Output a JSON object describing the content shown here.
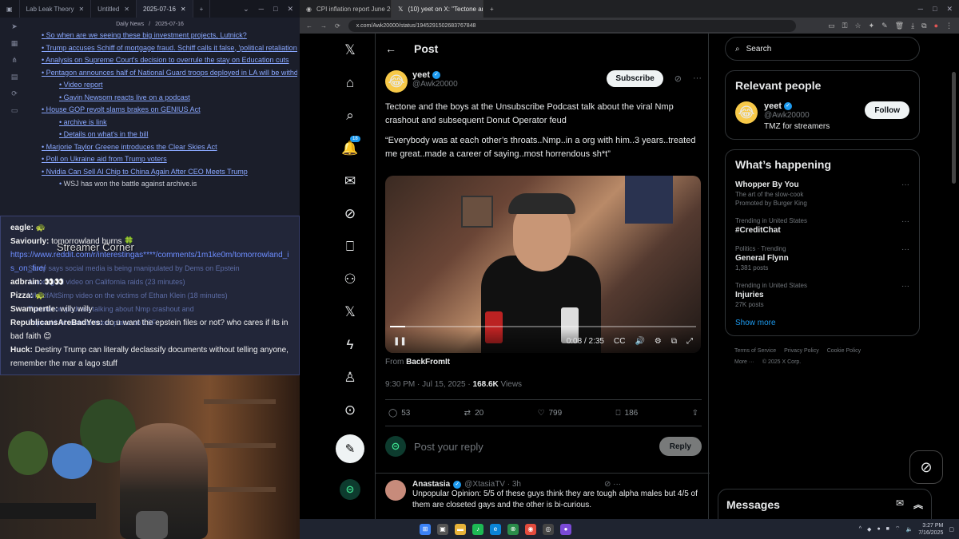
{
  "notes": {
    "tabs": [
      "Lab Leak Theory",
      "Untitled",
      "2025-07-16"
    ],
    "bar_left": "Daily News",
    "bar_right": "2025-07-16",
    "items": [
      {
        "text": "So when are we seeing these big investment projects, Lutnick?",
        "level": 1
      },
      {
        "text": "Trump accuses Schiff of mortgage fraud. Schiff calls it false, 'political retaliation' - Los Angeles Times",
        "level": 1
      },
      {
        "text": "Analysis on Supreme Court's decision to overrule the stay on Education cuts",
        "level": 1
      },
      {
        "text": "Pentagon announces half of National Guard troops deployed in LA will be withdrawn",
        "level": 1
      },
      {
        "text": "Video report",
        "level": 2
      },
      {
        "text": "Gavin Newsom reacts live on a podcast",
        "level": 2
      },
      {
        "text": "House GOP revolt slams brakes on GENIUS Act",
        "level": 1
      },
      {
        "text": "archive is link",
        "level": 2
      },
      {
        "text": "Details on what's in the bill",
        "level": 2
      },
      {
        "text": "Marjorie Taylor Greene introduces the Clear Skies Act",
        "level": 1
      },
      {
        "text": "Poll on Ukraine aid from Trump voters",
        "level": 1
      },
      {
        "text": "Nvidia Can Sell AI Chip to China Again After CEO Meets Trump",
        "level": 1
      },
      {
        "text": "WSJ has won the battle against archive.is",
        "level": 3
      }
    ]
  },
  "chat": {
    "title": "Streamer Corner",
    "ghost_lines": [
      "Study says social media is being manipulated by Dems on Epstein",
      "Asmongold video on California raids (23 minutes)",
      "WhatIfAltSimp video on the victims of Ethan Klein (18 minutes)",
      "Tectone on podcast talking about Nmp crashout and",
      "Pope-old lob debate takes place on LSF"
    ],
    "messages": [
      {
        "user": "eagle:",
        "text": "🐢"
      },
      {
        "user": "Saviourly:",
        "text": "tomorrowland burns 🍀"
      },
      {
        "user": "",
        "text": "https://www.reddit.com/r/interestingas****/comments/1m1ke0m/tomorrowland_is_on_fire/",
        "link": true
      },
      {
        "user": "adbrain:",
        "text": "👀👀"
      },
      {
        "user": "Pizza:",
        "text": "🐢"
      },
      {
        "user": "Swampertle:",
        "text": "willy willy"
      },
      {
        "user": "RepublicansAreBadYes:",
        "text": "do u want the epstein files or not? who cares if its in bad faith 😊"
      },
      {
        "user": "Huck:",
        "text": "Destiny Trump can literally declassify documents without telling anyone, remember the mar a lago stuff"
      }
    ]
  },
  "browser": {
    "tabs": [
      "CPI inflation report June 2025",
      "(10) yeet on X: \"Tectone and"
    ],
    "url": "x.com/Awk20000/status/1945291502683767848"
  },
  "x": {
    "page_title": "Post",
    "notification_count": "18",
    "author": {
      "name": "yeet",
      "handle": "@Awk20000"
    },
    "subscribe_label": "Subscribe",
    "text1": "Tectone and the boys at the Unsubscribe Podcast talk about the viral Nmp crashout and subsequent Donut Operator feud",
    "text2": "“Everybody was at each other’s throats..Nmp..in a org with him..3 years..treated me great..made a career of saying..most horrendous sh*t”",
    "video": {
      "time": "0:08 / 2:35",
      "progress": 0.05
    },
    "from_label": "From",
    "from_name": "BackFromIt",
    "time": "9:30 PM · Jul 15, 2025 ·",
    "views_count": "168.6K",
    "views_label": "Views",
    "actions": {
      "replies": "53",
      "reposts": "20",
      "likes": "799",
      "bookmarks": "186"
    },
    "reply_placeholder": "Post your reply",
    "reply_button": "Reply",
    "reply2": {
      "name": "Anastasia",
      "handle": "@XtasiaTV · 3h",
      "text": "Unpopular Opinion: 5/5 of these guys think they are tough alpha males but 4/5 of them are closeted gays and the other is bi-curious."
    },
    "search_placeholder": "Search",
    "relevant": {
      "title": "Relevant people",
      "name": "yeet",
      "handle": "@Awk20000",
      "bio": "TMZ for streamers",
      "follow": "Follow"
    },
    "happening": {
      "title": "What’s happening",
      "items": [
        {
          "context": "",
          "name": "Whopper By You",
          "sub": "The art of the slow-cook",
          "promo": "Promoted by Burger King"
        },
        {
          "context": "Trending in United States",
          "name": "#CreditChat",
          "sub": ""
        },
        {
          "context": "Politics · Trending",
          "name": "General Flynn",
          "sub": "1,381 posts"
        },
        {
          "context": "Trending in United States",
          "name": "Injuries",
          "sub": "27K posts"
        }
      ],
      "show_more": "Show more"
    },
    "footer": [
      "Terms of Service",
      "Privacy Policy",
      "Cookie Policy",
      "More ···",
      "© 2025 X Corp."
    ],
    "messages_label": "Messages"
  },
  "taskbar": {
    "time": "3:27 PM",
    "date": "7/16/2025"
  }
}
